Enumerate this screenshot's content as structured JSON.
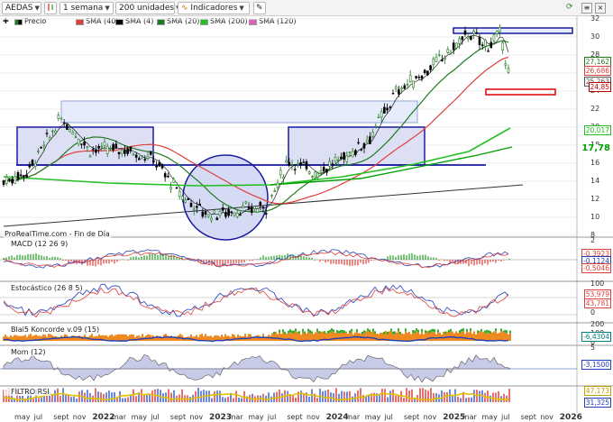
{
  "toolbar": {
    "ticker": "AEDAS",
    "period": "1 semana",
    "units": "200 unidades",
    "indicators": "Indicadores"
  },
  "legend": {
    "price_label": "Precio",
    "sma": [
      {
        "label": "SMA (40)",
        "color": "#e0403a"
      },
      {
        "label": "SMA (4)",
        "color": "#000000"
      },
      {
        "label": "SMA (20)",
        "color": "#1f7a1f"
      },
      {
        "label": "SMA (200)",
        "color": "#22c022"
      },
      {
        "label": "SMA (120)",
        "color": "#e060c0"
      }
    ]
  },
  "main": {
    "watermark": "ProRealTime.com - Fin de Día",
    "y_ticks": [
      "32",
      "30",
      "28",
      "26",
      "24",
      "22",
      "20",
      "18",
      "16",
      "14",
      "12",
      "10",
      "8"
    ],
    "price_tags": [
      {
        "text": "27,162",
        "color": "#1f7a1f"
      },
      {
        "text": "26,686",
        "color": "#e0403a"
      },
      {
        "text": "25,263",
        "color": "#555555"
      },
      {
        "text": "24,85",
        "color": "#c00000"
      },
      {
        "text": "20,017",
        "color": "#22c022"
      },
      {
        "text": "17,78",
        "color": "#00a000"
      }
    ]
  },
  "panels": [
    {
      "label": "MACD (12 26 9)",
      "ticks": [
        "2",
        "0",
        "-2"
      ],
      "tags": [
        {
          "text": "-0,3923",
          "color": "#e0403a"
        },
        {
          "text": "-0,1124",
          "color": "#1f3fbf"
        },
        {
          "text": "-0,5046",
          "color": "#e0403a"
        }
      ]
    },
    {
      "label": "Estocástico (26 8 5)",
      "ticks": [
        "100",
        "50",
        "0"
      ],
      "tags": [
        {
          "text": "53,979",
          "color": "#e0403a"
        },
        {
          "text": "43,781",
          "color": "#e0403a"
        }
      ]
    },
    {
      "label": "Blai5 Koncorde v.09 (15)",
      "ticks": [
        "200",
        "100",
        "0"
      ],
      "tags": [
        {
          "text": "-6,4304",
          "color": "#008080"
        }
      ]
    },
    {
      "label": "Mom (12)",
      "ticks": [
        "5",
        "0"
      ],
      "tags": [
        {
          "text": "-3,1500",
          "color": "#1f3fbf"
        }
      ]
    },
    {
      "label": "FILTRO RSI",
      "ticks": [
        "100",
        "50"
      ],
      "tags": [
        {
          "text": "47,173",
          "color": "#c0a000"
        },
        {
          "text": "31,325",
          "color": "#1f3fbf"
        }
      ]
    }
  ],
  "x_labels": [
    "may",
    "jul",
    "sept",
    "nov",
    "2022",
    "mar",
    "may",
    "jul",
    "sept",
    "nov",
    "2023",
    "mar",
    "may",
    "jul",
    "sept",
    "nov",
    "2024",
    "mar",
    "may",
    "jul",
    "sept",
    "nov",
    "2025",
    "mar",
    "may",
    "jul",
    "sept",
    "nov",
    "2026"
  ],
  "colors": {
    "candle_up": "#1f7a1f",
    "candle_down": "#000000",
    "box": "#1a1aa0",
    "box_fill": "#dde0f4",
    "sma_long": "#22c022"
  }
}
